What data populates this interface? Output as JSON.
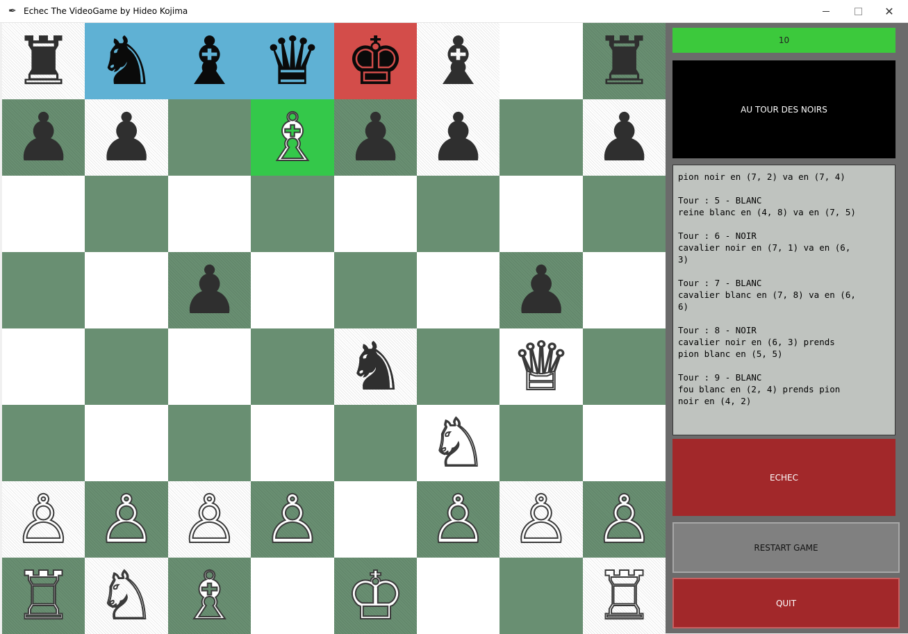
{
  "window": {
    "title": "Echec The VideoGame by Hideo Kojima",
    "icon": "feather-icon"
  },
  "board": {
    "squares": [
      [
        {
          "color": "light",
          "piece": "♜",
          "side": "faded"
        },
        {
          "color": "blue",
          "piece": "♞",
          "side": "black"
        },
        {
          "color": "blue",
          "piece": "♝",
          "side": "black"
        },
        {
          "color": "blue",
          "piece": "♛",
          "side": "black"
        },
        {
          "color": "red",
          "piece": "♚",
          "side": "black"
        },
        {
          "color": "light",
          "piece": "♝",
          "side": "faded"
        },
        {
          "color": "light",
          "piece": "",
          "side": ""
        },
        {
          "color": "dark",
          "piece": "♜",
          "side": "faded"
        }
      ],
      [
        {
          "color": "dark",
          "piece": "♟",
          "side": "faded"
        },
        {
          "color": "light",
          "piece": "♟",
          "side": "faded"
        },
        {
          "color": "dark",
          "piece": "",
          "side": ""
        },
        {
          "color": "green",
          "piece": "♗",
          "side": "white"
        },
        {
          "color": "dark",
          "piece": "♟",
          "side": "faded"
        },
        {
          "color": "light",
          "piece": "♟",
          "side": "faded"
        },
        {
          "color": "dark",
          "piece": "",
          "side": ""
        },
        {
          "color": "light",
          "piece": "♟",
          "side": "faded"
        }
      ],
      [
        {
          "color": "light",
          "piece": "",
          "side": ""
        },
        {
          "color": "dark",
          "piece": "",
          "side": ""
        },
        {
          "color": "light",
          "piece": "",
          "side": ""
        },
        {
          "color": "dark",
          "piece": "",
          "side": ""
        },
        {
          "color": "light",
          "piece": "",
          "side": ""
        },
        {
          "color": "dark",
          "piece": "",
          "side": ""
        },
        {
          "color": "light",
          "piece": "",
          "side": ""
        },
        {
          "color": "dark",
          "piece": "",
          "side": ""
        }
      ],
      [
        {
          "color": "dark",
          "piece": "",
          "side": ""
        },
        {
          "color": "light",
          "piece": "",
          "side": ""
        },
        {
          "color": "dark",
          "piece": "♟",
          "side": "faded"
        },
        {
          "color": "light",
          "piece": "",
          "side": ""
        },
        {
          "color": "dark",
          "piece": "",
          "side": ""
        },
        {
          "color": "light",
          "piece": "",
          "side": ""
        },
        {
          "color": "dark",
          "piece": "♟",
          "side": "faded"
        },
        {
          "color": "light",
          "piece": "",
          "side": ""
        }
      ],
      [
        {
          "color": "light",
          "piece": "",
          "side": ""
        },
        {
          "color": "dark",
          "piece": "",
          "side": ""
        },
        {
          "color": "light",
          "piece": "",
          "side": ""
        },
        {
          "color": "dark",
          "piece": "",
          "side": ""
        },
        {
          "color": "light",
          "piece": "♞",
          "side": "faded"
        },
        {
          "color": "dark",
          "piece": "",
          "side": ""
        },
        {
          "color": "light",
          "piece": "♕",
          "side": "white"
        },
        {
          "color": "dark",
          "piece": "",
          "side": ""
        }
      ],
      [
        {
          "color": "dark",
          "piece": "",
          "side": ""
        },
        {
          "color": "light",
          "piece": "",
          "side": ""
        },
        {
          "color": "dark",
          "piece": "",
          "side": ""
        },
        {
          "color": "light",
          "piece": "",
          "side": ""
        },
        {
          "color": "dark",
          "piece": "",
          "side": ""
        },
        {
          "color": "light",
          "piece": "♘",
          "side": "white"
        },
        {
          "color": "dark",
          "piece": "",
          "side": ""
        },
        {
          "color": "light",
          "piece": "",
          "side": ""
        }
      ],
      [
        {
          "color": "light",
          "piece": "♙",
          "side": "white"
        },
        {
          "color": "dark",
          "piece": "♙",
          "side": "white"
        },
        {
          "color": "light",
          "piece": "♙",
          "side": "white"
        },
        {
          "color": "dark",
          "piece": "♙",
          "side": "white"
        },
        {
          "color": "light",
          "piece": "",
          "side": ""
        },
        {
          "color": "dark",
          "piece": "♙",
          "side": "white"
        },
        {
          "color": "light",
          "piece": "♙",
          "side": "white"
        },
        {
          "color": "dark",
          "piece": "♙",
          "side": "white"
        }
      ],
      [
        {
          "color": "dark",
          "piece": "♖",
          "side": "white"
        },
        {
          "color": "light",
          "piece": "♘",
          "side": "white"
        },
        {
          "color": "dark",
          "piece": "♗",
          "side": "white"
        },
        {
          "color": "light",
          "piece": "",
          "side": ""
        },
        {
          "color": "dark",
          "piece": "♔",
          "side": "white"
        },
        {
          "color": "light",
          "piece": "",
          "side": ""
        },
        {
          "color": "dark",
          "piece": "",
          "side": ""
        },
        {
          "color": "light",
          "piece": "♖",
          "side": "white"
        }
      ]
    ]
  },
  "panel": {
    "counter": "10",
    "turn_label": "AU TOUR DES NOIRS",
    "log": "pion noir en (7, 2) va en (7, 4)\n\nTour : 5 - BLANC\nreine blanc en (4, 8) va en (7, 5)\n\nTour : 6 - NOIR\ncavalier noir en (7, 1) va en (6,\n3)\n\nTour : 7 - BLANC\ncavalier blanc en (7, 8) va en (6,\n6)\n\nTour : 8 - NOIR\ncavalier noir en (6, 3) prends\npion blanc en (5, 5)\n\nTour : 9 - BLANC\nfou blanc en (2, 4) prends pion\nnoir en (4, 2)",
    "echec_label": "ECHEC",
    "restart_label": "RESTART GAME",
    "quit_label": "QUIT"
  },
  "colors": {
    "light_square": "#ffffff",
    "dark_square": "#698f72",
    "selected_blue": "#5fb1d4",
    "check_red": "#d34d4a",
    "move_green": "#34c84a",
    "counter_green": "#3cc93c",
    "button_red": "#a2282a",
    "button_grey": "#808080"
  }
}
